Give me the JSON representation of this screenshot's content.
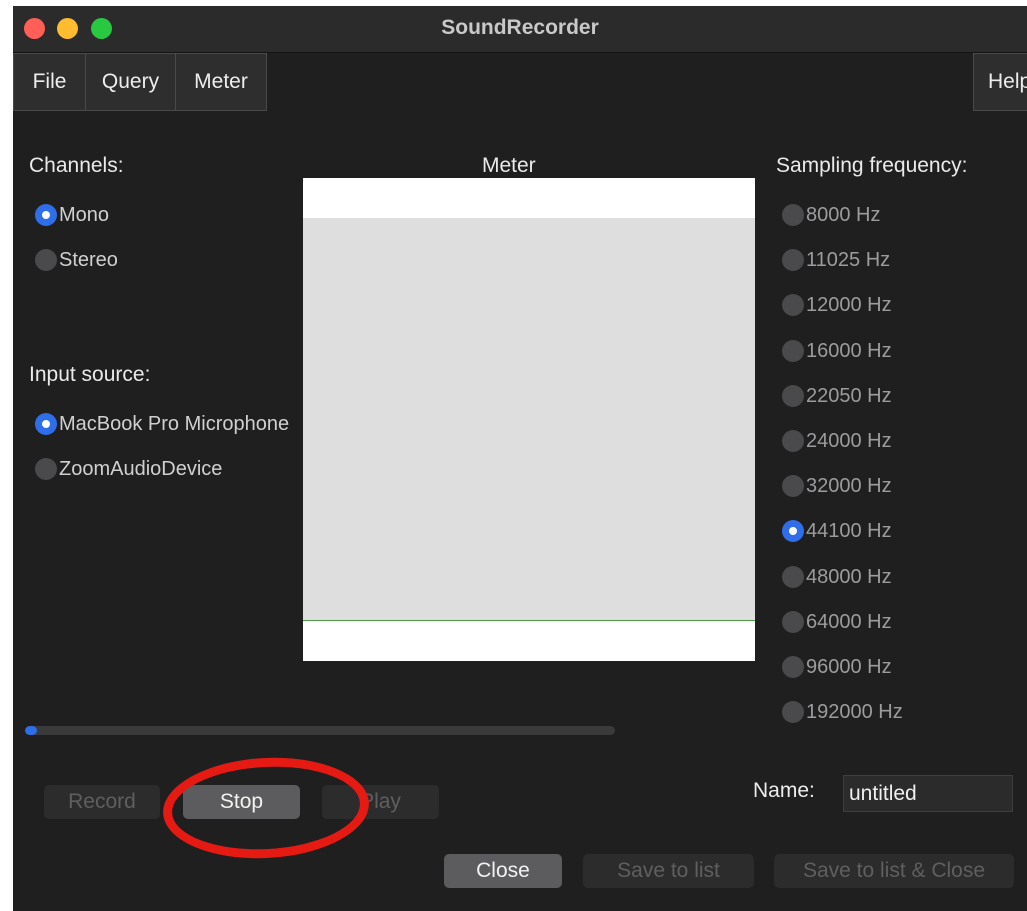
{
  "window": {
    "title": "SoundRecorder"
  },
  "menu": {
    "file": "File",
    "query": "Query",
    "meter": "Meter",
    "help": "Help"
  },
  "channels": {
    "label": "Channels:",
    "options": [
      {
        "label": "Mono",
        "selected": true
      },
      {
        "label": "Stereo",
        "selected": false
      }
    ]
  },
  "input_source": {
    "label": "Input source:",
    "options": [
      {
        "label": "MacBook Pro Microphone",
        "selected": true
      },
      {
        "label": "ZoomAudioDevice",
        "selected": false
      }
    ]
  },
  "meter": {
    "title": "Meter"
  },
  "sampling": {
    "label": "Sampling frequency:",
    "selected": "44100 Hz",
    "options": [
      "8000 Hz",
      "11025 Hz",
      "12000 Hz",
      "16000 Hz",
      "22050 Hz",
      "24000 Hz",
      "32000 Hz",
      "44100 Hz",
      "48000 Hz",
      "64000 Hz",
      "96000 Hz",
      "192000 Hz"
    ]
  },
  "progress": {
    "value": 0.02
  },
  "buttons": {
    "record": "Record",
    "stop": "Stop",
    "play": "Play",
    "close": "Close",
    "save_to_list": "Save to list",
    "save_to_list_close": "Save to list & Close"
  },
  "name": {
    "label": "Name:",
    "value": "untitled"
  },
  "colors": {
    "accent": "#2f6ee8",
    "annotation": "#e51a13",
    "meter_line": "#4f9a4a"
  }
}
